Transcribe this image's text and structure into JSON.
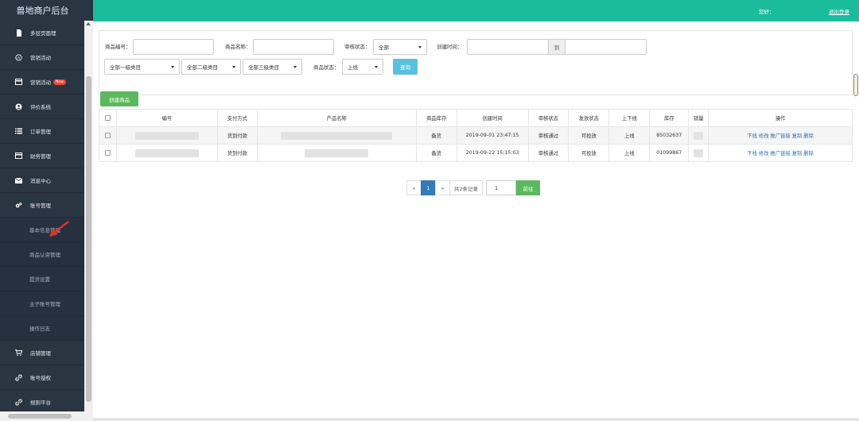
{
  "app": {
    "title": "兽地商户后台"
  },
  "topbar": {
    "greeting": "您好：",
    "logout": "退出登录"
  },
  "sidebar": {
    "items": [
      {
        "label": "多层页面理",
        "icon": "document-icon"
      },
      {
        "label": "营销活动",
        "icon": "megaphone-icon"
      },
      {
        "label": "营销活动",
        "icon": "card-icon",
        "badge": "New"
      },
      {
        "label": "评价系统",
        "icon": "user-circle-icon"
      },
      {
        "label": "订单管理",
        "icon": "list-icon"
      },
      {
        "label": "财务管理",
        "icon": "card-icon"
      },
      {
        "label": "消息中心",
        "icon": "mail-icon"
      },
      {
        "label": "账号管理",
        "icon": "gears-icon"
      }
    ],
    "subitems": [
      {
        "label": "基本信息管理"
      },
      {
        "label": "商品认资管理"
      },
      {
        "label": "提货设置"
      },
      {
        "label": "主子账号管理"
      },
      {
        "label": "操作日志"
      }
    ],
    "bottom_items": [
      {
        "label": "店铺管理",
        "icon": "cart-icon"
      },
      {
        "label": "账号授权",
        "icon": "link-icon"
      },
      {
        "label": "规则平台",
        "icon": "link-icon"
      }
    ]
  },
  "filters": {
    "product_no_label": "商品编号：",
    "product_name_label": "商品名称：",
    "audit_status_label": "审核状态：",
    "audit_status_value": "全部",
    "created_time_label": "创建时间：",
    "range_sep": "到",
    "cat1": "全部一级类目",
    "cat2": "全部二级类目",
    "cat3": "全部三级类目",
    "product_status_label": "商品状态：",
    "product_status_value": "上线",
    "search_button": "查询"
  },
  "create_button": "创建商品",
  "table": {
    "headers": [
      "编号",
      "支付方式",
      "产品名称",
      "商品库存",
      "创建时间",
      "审核状态",
      "发放状态",
      "上下线",
      "库存",
      "销量",
      "操作"
    ],
    "rows": [
      {
        "pay": "货到付款",
        "stock_type": "备货",
        "created": "2019-09-01 23:47:15",
        "audit": "审核通过",
        "issue": "可投放",
        "online": "上线",
        "stock": "85032637"
      },
      {
        "pay": "货到付款",
        "stock_type": "备货",
        "created": "2019-09-22 15:15:03",
        "audit": "审核通过",
        "issue": "可投放",
        "online": "上线",
        "stock": "01099867"
      }
    ],
    "ops": [
      "下线",
      "修改",
      "推广链接",
      "复制",
      "删除"
    ]
  },
  "pagination": {
    "prev": "«",
    "current": "1",
    "next": "»",
    "total": "共2条记录",
    "jump_value": "1",
    "go": "前往"
  }
}
